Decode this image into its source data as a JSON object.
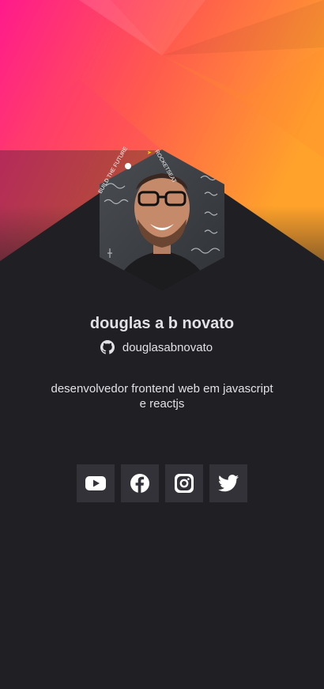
{
  "profile": {
    "name": "douglas a b novato",
    "github_username": "douglasabnovato",
    "bio": "desenvolvedor frontend web em javascript e reactjs"
  },
  "avatar": {
    "badge_text": "BUILD THE FUTURE · ROCKETSEAT"
  },
  "socials": [
    {
      "name": "youtube-icon"
    },
    {
      "name": "facebook-icon"
    },
    {
      "name": "instagram-icon"
    },
    {
      "name": "twitter-icon"
    }
  ],
  "colors": {
    "background": "#202024",
    "button_bg": "#323238",
    "gradient_pink": "#ff1a8c",
    "gradient_orange": "#ffa22b",
    "text": "#e1e1e6"
  }
}
